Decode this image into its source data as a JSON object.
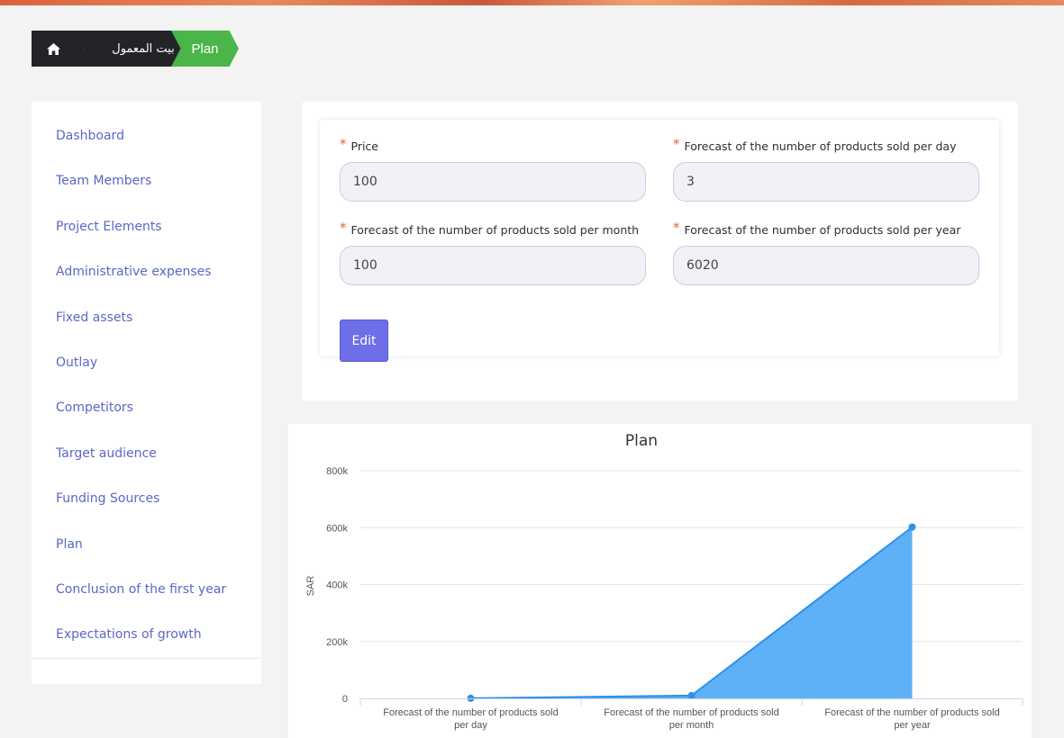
{
  "breadcrumb": {
    "home_icon": "home-icon",
    "project": "بيت المعمول",
    "current": "Plan"
  },
  "sidebar": {
    "items": [
      {
        "label": "Dashboard"
      },
      {
        "label": "Team Members"
      },
      {
        "label": "Project Elements"
      },
      {
        "label": "Administrative expenses"
      },
      {
        "label": "Fixed assets"
      },
      {
        "label": "Outlay"
      },
      {
        "label": "Competitors"
      },
      {
        "label": "Target audience"
      },
      {
        "label": "Funding Sources"
      },
      {
        "label": "Plan"
      },
      {
        "label": "Conclusion of the first year"
      },
      {
        "label": "Expectations of growth"
      }
    ]
  },
  "form": {
    "required_mark": "*",
    "price": {
      "label": "Price",
      "value": "100"
    },
    "per_day": {
      "label": "Forecast of the number of products sold per day",
      "value": "3"
    },
    "per_month": {
      "label": "Forecast of the number of products sold per month",
      "value": "100"
    },
    "per_year": {
      "label": "Forecast of the number of products sold per year",
      "value": "6020"
    },
    "edit_label": "Edit"
  },
  "colors": {
    "accent": "#6e6ee8",
    "breadcrumb_active": "#4ab548",
    "breadcrumb_dark": "#232428",
    "link": "#5b67c7",
    "chart_fill": "#4ca8f5",
    "chart_line": "#2f8fe8"
  },
  "chart_data": {
    "type": "area",
    "title": "Plan",
    "ylabel": "SAR",
    "xlabel": "",
    "categories": [
      "Forecast of the number of products sold per day",
      "Forecast of the number of products sold per month",
      "Forecast of the number of products sold per year"
    ],
    "category_lines": [
      [
        "Forecast of the number of products sold",
        "per day"
      ],
      [
        "Forecast of the number of products sold",
        "per month"
      ],
      [
        "Forecast of the number of products sold",
        "per year"
      ]
    ],
    "values": [
      300,
      10000,
      602000
    ],
    "ylim": [
      0,
      800000
    ],
    "yticks": [
      0,
      200000,
      400000,
      600000,
      800000
    ],
    "ytick_labels": [
      "0",
      "200k",
      "400k",
      "600k",
      "800k"
    ],
    "grid": true,
    "legend": "none"
  }
}
